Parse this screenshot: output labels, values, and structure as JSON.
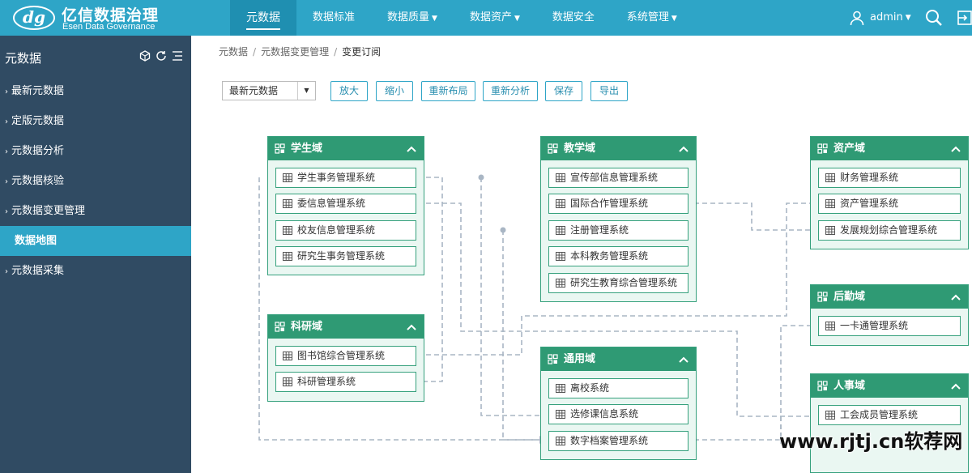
{
  "brand": {
    "mark": "dg",
    "title": "亿信数据治理",
    "subtitle": "Esen Data Governance"
  },
  "nav": [
    {
      "label": "元数据",
      "dropdown": false,
      "active": true
    },
    {
      "label": "数据标准",
      "dropdown": false
    },
    {
      "label": "数据质量",
      "dropdown": true
    },
    {
      "label": "数据资产",
      "dropdown": true
    },
    {
      "label": "数据安全",
      "dropdown": false
    },
    {
      "label": "系统管理",
      "dropdown": true
    }
  ],
  "user": {
    "name": "admin"
  },
  "sidebar": {
    "title": "元数据",
    "items": [
      {
        "label": "最新元数据"
      },
      {
        "label": "定版元数据"
      },
      {
        "label": "元数据分析"
      },
      {
        "label": "元数据核验"
      },
      {
        "label": "元数据变更管理"
      },
      {
        "label": "数据地图",
        "active": true
      },
      {
        "label": "元数据采集"
      }
    ]
  },
  "breadcrumb": [
    "元数据",
    "元数据变更管理",
    "变更订阅"
  ],
  "toolbar": {
    "select_value": "最新元数据",
    "buttons": [
      "放大",
      "缩小",
      "重新布局",
      "重新分析",
      "保存",
      "导出"
    ]
  },
  "domains": [
    {
      "key": "student",
      "title": "学生域",
      "systems": [
        "学生事务管理系统",
        "委信息管理系统",
        "校友信息管理系统",
        "研究生事务管理系统"
      ]
    },
    {
      "key": "teaching",
      "title": "教学域",
      "systems": [
        "宣传部信息管理系统",
        "国际合作管理系统",
        "注册管理系统",
        "本科教务管理系统",
        "研究生教育综合管理系统"
      ]
    },
    {
      "key": "asset",
      "title": "资产域",
      "systems": [
        "财务管理系统",
        "资产管理系统",
        "发展规划综合管理系统"
      ]
    },
    {
      "key": "research",
      "title": "科研域",
      "systems": [
        "图书馆综合管理系统",
        "科研管理系统"
      ]
    },
    {
      "key": "common",
      "title": "通用域",
      "systems": [
        "离校系统",
        "选修课信息系统",
        "数字档案管理系统"
      ]
    },
    {
      "key": "logistics",
      "title": "后勤域",
      "systems": [
        "一卡通管理系统"
      ]
    },
    {
      "key": "hr",
      "title": "人事域",
      "systems": [
        "工会成员管理系统"
      ]
    }
  ],
  "watermark": "www.rjtj.cn软荐网",
  "colors": {
    "topbar": "#2ea5c7",
    "sidebar": "#304b63",
    "domain_header": "#2f9a74",
    "domain_body": "#eaf7f2",
    "link": "#a9b6c4"
  }
}
